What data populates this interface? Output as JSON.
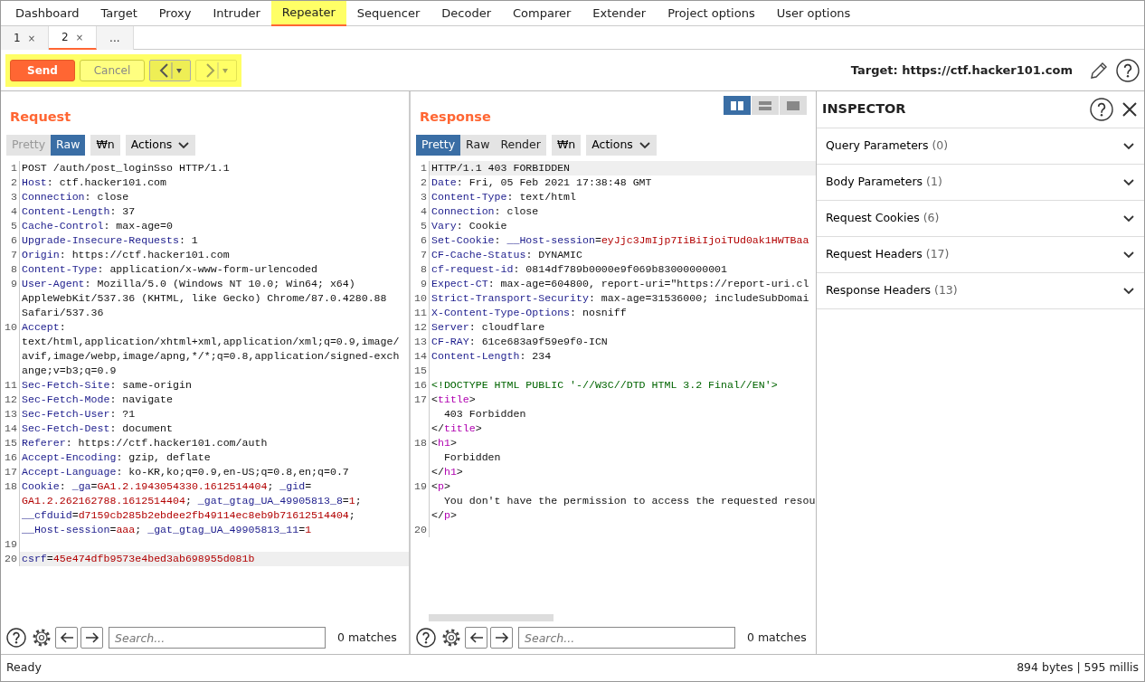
{
  "main_tabs": [
    {
      "label": "Dashboard",
      "selected": false
    },
    {
      "label": "Target",
      "selected": false
    },
    {
      "label": "Proxy",
      "selected": false
    },
    {
      "label": "Intruder",
      "selected": false
    },
    {
      "label": "Repeater",
      "selected": true
    },
    {
      "label": "Sequencer",
      "selected": false
    },
    {
      "label": "Decoder",
      "selected": false
    },
    {
      "label": "Comparer",
      "selected": false
    },
    {
      "label": "Extender",
      "selected": false
    },
    {
      "label": "Project options",
      "selected": false
    },
    {
      "label": "User options",
      "selected": false
    }
  ],
  "sub_tabs": [
    {
      "label": "1",
      "close": "×",
      "selected": false
    },
    {
      "label": "2",
      "close": "×",
      "selected": true
    },
    {
      "label": "...",
      "selected": false
    }
  ],
  "toolbar": {
    "send": {
      "label": "Send"
    },
    "cancel": {
      "label": "Cancel",
      "disabled": true
    },
    "back": {
      "disabled": false
    },
    "forward": {
      "disabled": true
    },
    "target": "Target: https://ctf.hacker101.com"
  },
  "request": {
    "title": "Request",
    "tabs": [
      {
        "label": "Pretty",
        "selected": false,
        "disabled": true
      },
      {
        "label": "Raw",
        "selected": true,
        "disabled": false
      }
    ],
    "newline_button": "₩n",
    "actions": "Actions",
    "lines": [
      {
        "num": "1",
        "current": false,
        "parts": [
          {
            "kind": "plain",
            "text": "POST /auth/post_loginSso HTTP/1.1"
          }
        ]
      },
      {
        "num": "2",
        "current": false,
        "parts": [
          {
            "kind": "key",
            "text": "Host"
          },
          {
            "kind": "plain",
            "text": ": ctf.hacker101.com"
          }
        ]
      },
      {
        "num": "3",
        "current": false,
        "parts": [
          {
            "kind": "key",
            "text": "Connection"
          },
          {
            "kind": "plain",
            "text": ": close"
          }
        ]
      },
      {
        "num": "4",
        "current": false,
        "parts": [
          {
            "kind": "key",
            "text": "Content-Length"
          },
          {
            "kind": "plain",
            "text": ": 37"
          }
        ]
      },
      {
        "num": "5",
        "current": false,
        "parts": [
          {
            "kind": "key",
            "text": "Cache-Control"
          },
          {
            "kind": "plain",
            "text": ": max-age=0"
          }
        ]
      },
      {
        "num": "6",
        "current": false,
        "parts": [
          {
            "kind": "key",
            "text": "Upgrade-Insecure-Requests"
          },
          {
            "kind": "plain",
            "text": ": 1"
          }
        ]
      },
      {
        "num": "7",
        "current": false,
        "parts": [
          {
            "kind": "key",
            "text": "Origin"
          },
          {
            "kind": "plain",
            "text": ": https://ctf.hacker101.com"
          }
        ]
      },
      {
        "num": "8",
        "current": false,
        "parts": [
          {
            "kind": "key",
            "text": "Content-Type"
          },
          {
            "kind": "plain",
            "text": ": application/x-www-form-urlencoded"
          }
        ]
      },
      {
        "num": "9",
        "current": false,
        "parts": [
          {
            "kind": "key",
            "text": "User-Agent"
          },
          {
            "kind": "plain",
            "text": ": Mozilla/5.0 (Windows NT 10.0; Win64; x64)"
          }
        ]
      },
      {
        "current": false,
        "parts": [
          {
            "kind": "plain",
            "text": "AppleWebKit/537.36 (KHTML, like Gecko) Chrome/87.0.4280.88"
          }
        ]
      },
      {
        "current": false,
        "parts": [
          {
            "kind": "plain",
            "text": "Safari/537.36"
          }
        ]
      },
      {
        "num": "10",
        "current": false,
        "parts": [
          {
            "kind": "key",
            "text": "Accept"
          },
          {
            "kind": "plain",
            "text": ":"
          }
        ]
      },
      {
        "current": false,
        "parts": [
          {
            "kind": "plain",
            "text": "text/html,application/xhtml+xml,application/xml;q=0.9,image/"
          }
        ]
      },
      {
        "current": false,
        "parts": [
          {
            "kind": "plain",
            "text": "avif,image/webp,image/apng,*/*;q=0.8,application/signed-exch"
          }
        ]
      },
      {
        "current": false,
        "parts": [
          {
            "kind": "plain",
            "text": "ange;v=b3;q=0.9"
          }
        ]
      },
      {
        "num": "11",
        "current": false,
        "parts": [
          {
            "kind": "key",
            "text": "Sec-Fetch-Site"
          },
          {
            "kind": "plain",
            "text": ": same-origin"
          }
        ]
      },
      {
        "num": "12",
        "current": false,
        "parts": [
          {
            "kind": "key",
            "text": "Sec-Fetch-Mode"
          },
          {
            "kind": "plain",
            "text": ": navigate"
          }
        ]
      },
      {
        "num": "13",
        "current": false,
        "parts": [
          {
            "kind": "key",
            "text": "Sec-Fetch-User"
          },
          {
            "kind": "plain",
            "text": ": ?1"
          }
        ]
      },
      {
        "num": "14",
        "current": false,
        "parts": [
          {
            "kind": "key",
            "text": "Sec-Fetch-Dest"
          },
          {
            "kind": "plain",
            "text": ": document"
          }
        ]
      },
      {
        "num": "15",
        "current": false,
        "parts": [
          {
            "kind": "key",
            "text": "Referer"
          },
          {
            "kind": "plain",
            "text": ": https://ctf.hacker101.com/auth"
          }
        ]
      },
      {
        "num": "16",
        "current": false,
        "parts": [
          {
            "kind": "key",
            "text": "Accept-Encoding"
          },
          {
            "kind": "plain",
            "text": ": gzip, deflate"
          }
        ]
      },
      {
        "num": "17",
        "current": false,
        "parts": [
          {
            "kind": "key",
            "text": "Accept-Language"
          },
          {
            "kind": "plain",
            "text": ": ko-KR,ko;q=0.9,en-US;q=0.8,en;q=0.7"
          }
        ]
      },
      {
        "num": "18",
        "current": false,
        "parts": [
          {
            "kind": "key",
            "text": "Cookie"
          },
          {
            "kind": "plain",
            "text": ": "
          },
          {
            "kind": "key",
            "text": "_ga"
          },
          {
            "kind": "plain",
            "text": "="
          },
          {
            "kind": "value",
            "text": "GA1.2.1943054330.1612514404"
          },
          {
            "kind": "plain",
            "text": "; "
          },
          {
            "kind": "key",
            "text": "_gid"
          },
          {
            "kind": "plain",
            "text": "="
          }
        ]
      },
      {
        "current": false,
        "parts": [
          {
            "kind": "value",
            "text": "GA1.2.262162788.1612514404"
          },
          {
            "kind": "plain",
            "text": "; "
          },
          {
            "kind": "key",
            "text": "_gat_gtag_UA_49905813_8"
          },
          {
            "kind": "plain",
            "text": "="
          },
          {
            "kind": "value",
            "text": "1"
          },
          {
            "kind": "plain",
            "text": ";"
          }
        ]
      },
      {
        "current": false,
        "parts": [
          {
            "kind": "key",
            "text": "__cfduid"
          },
          {
            "kind": "plain",
            "text": "="
          },
          {
            "kind": "value",
            "text": "d7159cb285b2ebdee2fb49114ec8eb9b71612514404"
          },
          {
            "kind": "plain",
            "text": ";"
          }
        ]
      },
      {
        "current": false,
        "parts": [
          {
            "kind": "key",
            "text": "__Host-session"
          },
          {
            "kind": "plain",
            "text": "="
          },
          {
            "kind": "value",
            "text": "aaa"
          },
          {
            "kind": "plain",
            "text": "; "
          },
          {
            "kind": "key",
            "text": "_gat_gtag_UA_49905813_11"
          },
          {
            "kind": "plain",
            "text": "="
          },
          {
            "kind": "value",
            "text": "1"
          }
        ]
      },
      {
        "num": "19",
        "current": false
      },
      {
        "num": "20",
        "current": true,
        "parts": [
          {
            "kind": "key",
            "text": "csrf"
          },
          {
            "kind": "plain",
            "text": "="
          },
          {
            "kind": "value",
            "text": "45e474dfb9573e4bed3ab698955d081b"
          }
        ]
      }
    ],
    "search": {
      "placeholder": "Search...",
      "matches": "0 matches"
    }
  },
  "response": {
    "title": "Response",
    "view_modes": [
      {
        "selected": true
      },
      {
        "selected": false
      },
      {
        "selected": false
      }
    ],
    "tabs": [
      {
        "label": "Pretty",
        "selected": true,
        "disabled": false
      },
      {
        "label": "Raw",
        "selected": false,
        "disabled": false
      },
      {
        "label": "Render",
        "selected": false,
        "disabled": false
      }
    ],
    "newline_button": "₩n",
    "actions": "Actions",
    "lines": [
      {
        "num": "1",
        "current": true,
        "parts": [
          {
            "kind": "plain",
            "text": "HTTP/1.1 403 FORBIDDEN"
          }
        ]
      },
      {
        "num": "2",
        "current": false,
        "parts": [
          {
            "kind": "key",
            "text": "Date"
          },
          {
            "kind": "plain",
            "text": ": Fri, 05 Feb 2021 17:38:48 GMT"
          }
        ]
      },
      {
        "num": "3",
        "current": false,
        "parts": [
          {
            "kind": "key",
            "text": "Content-Type"
          },
          {
            "kind": "plain",
            "text": ": text/html"
          }
        ]
      },
      {
        "num": "4",
        "current": false,
        "parts": [
          {
            "kind": "key",
            "text": "Connection"
          },
          {
            "kind": "plain",
            "text": ": close"
          }
        ]
      },
      {
        "num": "5",
        "current": false,
        "parts": [
          {
            "kind": "key",
            "text": "Vary"
          },
          {
            "kind": "plain",
            "text": ": Cookie"
          }
        ]
      },
      {
        "num": "6",
        "current": false,
        "parts": [
          {
            "kind": "key",
            "text": "Set-Cookie"
          },
          {
            "kind": "plain",
            "text": ": "
          },
          {
            "kind": "key",
            "text": "__Host-session"
          },
          {
            "kind": "plain",
            "text": "="
          },
          {
            "kind": "value",
            "text": "eyJjc3JmIjp7IiBiIjoiTUd0ak1HWTBaa"
          }
        ]
      },
      {
        "num": "7",
        "current": false,
        "parts": [
          {
            "kind": "key",
            "text": "CF-Cache-Status"
          },
          {
            "kind": "plain",
            "text": ": DYNAMIC"
          }
        ]
      },
      {
        "num": "8",
        "current": false,
        "parts": [
          {
            "kind": "key",
            "text": "cf-request-id"
          },
          {
            "kind": "plain",
            "text": ": 0814df789b0000e9f069b83000000001"
          }
        ]
      },
      {
        "num": "9",
        "current": false,
        "parts": [
          {
            "kind": "key",
            "text": "Expect-CT"
          },
          {
            "kind": "plain",
            "text": ": max-age=604800, report-uri=\"https://report-uri.cl"
          }
        ]
      },
      {
        "num": "10",
        "current": false,
        "parts": [
          {
            "kind": "key",
            "text": "Strict-Transport-Security"
          },
          {
            "kind": "plain",
            "text": ": max-age=31536000; includeSubDomai"
          }
        ]
      },
      {
        "num": "11",
        "current": false,
        "parts": [
          {
            "kind": "key",
            "text": "X-Content-Type-Options"
          },
          {
            "kind": "plain",
            "text": ": nosniff"
          }
        ]
      },
      {
        "num": "12",
        "current": false,
        "parts": [
          {
            "kind": "key",
            "text": "Server"
          },
          {
            "kind": "plain",
            "text": ": cloudflare"
          }
        ]
      },
      {
        "num": "13",
        "current": false,
        "parts": [
          {
            "kind": "key",
            "text": "CF-RAY"
          },
          {
            "kind": "plain",
            "text": ": 61ce683a9f59e9f0-ICN"
          }
        ]
      },
      {
        "num": "14",
        "current": false,
        "parts": [
          {
            "kind": "key",
            "text": "Content-Length"
          },
          {
            "kind": "plain",
            "text": ": 234"
          }
        ]
      },
      {
        "num": "15",
        "current": false
      },
      {
        "num": "16",
        "current": false,
        "parts": [
          {
            "kind": "doctype",
            "text": "<!DOCTYPE HTML PUBLIC '-//W3C//DTD HTML 3.2 Final//EN'>"
          }
        ]
      },
      {
        "num": "17",
        "current": false,
        "parts": [
          {
            "kind": "plain",
            "text": "<"
          },
          {
            "kind": "tag",
            "text": "title"
          },
          {
            "kind": "plain",
            "text": ">"
          }
        ]
      },
      {
        "current": false,
        "parts": [
          {
            "kind": "plain",
            "text": "  403 Forbidden"
          }
        ]
      },
      {
        "current": false,
        "parts": [
          {
            "kind": "plain",
            "text": "</"
          },
          {
            "kind": "tag",
            "text": "title"
          },
          {
            "kind": "plain",
            "text": ">"
          }
        ]
      },
      {
        "num": "18",
        "current": false,
        "parts": [
          {
            "kind": "plain",
            "text": "<"
          },
          {
            "kind": "tag",
            "text": "h1"
          },
          {
            "kind": "plain",
            "text": ">"
          }
        ]
      },
      {
        "current": false,
        "parts": [
          {
            "kind": "plain",
            "text": "  Forbidden"
          }
        ]
      },
      {
        "current": false,
        "parts": [
          {
            "kind": "plain",
            "text": "</"
          },
          {
            "kind": "tag",
            "text": "h1"
          },
          {
            "kind": "plain",
            "text": ">"
          }
        ]
      },
      {
        "num": "19",
        "current": false,
        "parts": [
          {
            "kind": "plain",
            "text": "<"
          },
          {
            "kind": "tag",
            "text": "p"
          },
          {
            "kind": "plain",
            "text": ">"
          }
        ]
      },
      {
        "current": false,
        "parts": [
          {
            "kind": "plain",
            "text": "  You don't have the permission to access the requested resou"
          }
        ]
      },
      {
        "current": false,
        "parts": [
          {
            "kind": "plain",
            "text": "</"
          },
          {
            "kind": "tag",
            "text": "p"
          },
          {
            "kind": "plain",
            "text": ">"
          }
        ]
      },
      {
        "num": "20",
        "current": false
      }
    ],
    "search": {
      "placeholder": "Search...",
      "matches": "0 matches"
    }
  },
  "inspector": {
    "title": "INSPECTOR",
    "sections": [
      {
        "title": "Query Parameters",
        "count": "(0)",
        "expanded": false
      },
      {
        "title": "Body Parameters",
        "count": "(1)",
        "expanded": false
      },
      {
        "title": "Request Cookies",
        "count": "(6)",
        "expanded": false
      },
      {
        "title": "Request Headers",
        "count": "(17)",
        "expanded": false
      },
      {
        "title": "Response Headers",
        "count": "(13)",
        "expanded": false
      }
    ]
  },
  "status_bar": {
    "left": "Ready",
    "right": "894 bytes | 595 millis"
  }
}
